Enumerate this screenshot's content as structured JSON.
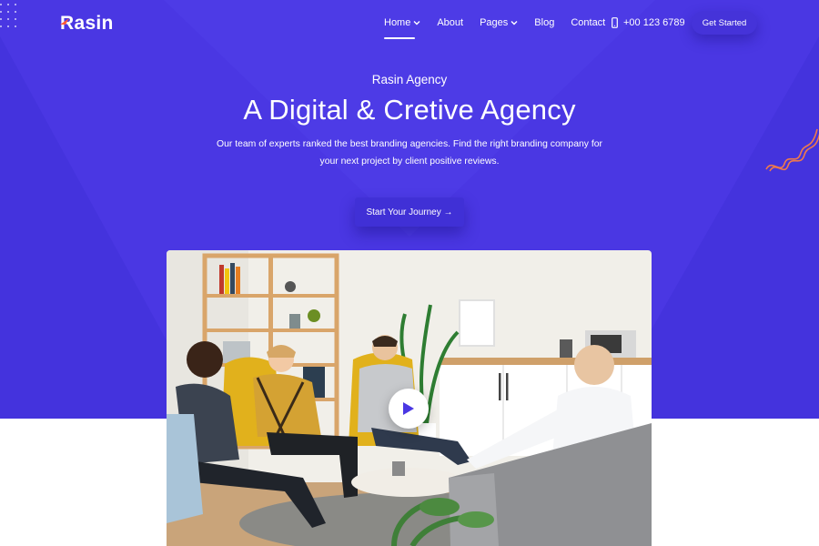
{
  "brand": {
    "name": "Rasin",
    "accent": "#4a37e3",
    "mark_color": "#ff5a36"
  },
  "nav": {
    "items": [
      {
        "label": "Home",
        "dropdown": true,
        "active": true
      },
      {
        "label": "About",
        "dropdown": false
      },
      {
        "label": "Pages",
        "dropdown": true
      },
      {
        "label": "Blog",
        "dropdown": false
      },
      {
        "label": "Contact",
        "dropdown": false
      }
    ],
    "phone": "+00 123 6789",
    "phone_icon": "phone-icon",
    "cta_label": "Get Started"
  },
  "hero": {
    "subtitle": "Rasin Agency",
    "headline": "A Digital & Cretive Agency",
    "description": "Our team of experts ranked the best branding agencies. Find the right branding company for your next project by client positive reviews.",
    "button_label": "Start Your Journey →"
  },
  "media": {
    "play_icon": "play-icon"
  }
}
